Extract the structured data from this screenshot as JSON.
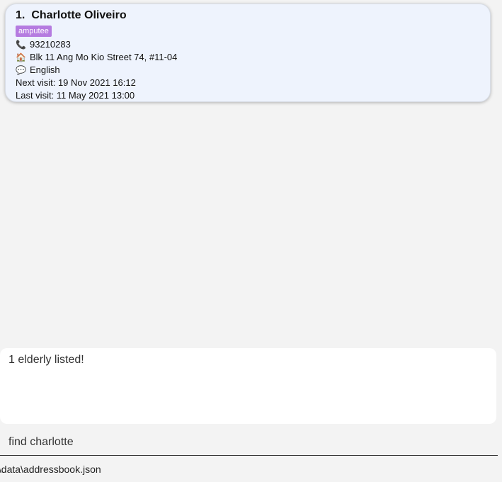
{
  "person": {
    "index": "1.",
    "name": "Charlotte Oliveiro",
    "tag": "amputee",
    "phone": "93210283",
    "address": "Blk 11 Ang Mo Kio Street 74, #11-04",
    "language": "English",
    "next_visit": "Next visit: 19 Nov 2021 16:12",
    "last_visit": "Last visit: 11 May 2021 13:00",
    "phone_icon": "phone-icon",
    "address_icon": "house-icon",
    "language_icon": "speech-bubble-icon"
  },
  "result": {
    "text": "1 elderly listed!"
  },
  "command": {
    "value": "find charlotte"
  },
  "status": {
    "path": ".\\data\\addressbook.json"
  },
  "colors": {
    "tag_bg": "#b57be0",
    "card_bg": "#eef3fd",
    "page_bg": "#f3f3f3"
  }
}
